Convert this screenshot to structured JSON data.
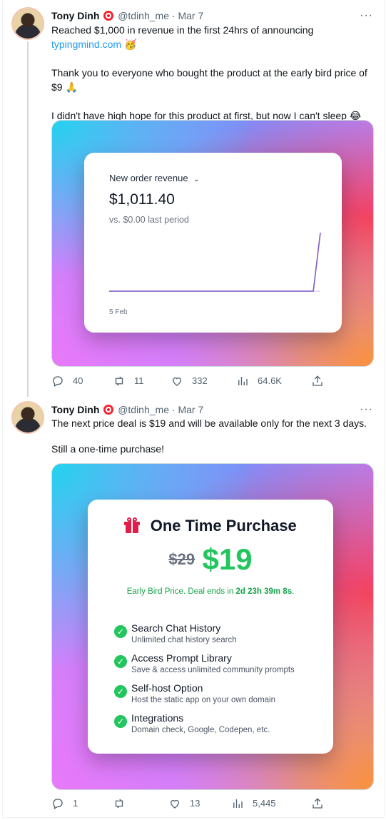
{
  "tweets": [
    {
      "author_name": "Tony Dinh",
      "handle": "@tdinh_me",
      "separator": "·",
      "date": "Mar 7",
      "text_line1": "Reached $1,000 in revenue in the first 24hrs of announcing",
      "link": "typingmind.com",
      "link_emoji": "🥳",
      "para2_line1": "Thank you to everyone who bought the product at the early bird price of",
      "para2_line2": "$9 🙏",
      "para3": "I didn't have high hope for this product at first, but now I can't sleep 😂",
      "media": {
        "dropdown_label": "New order revenue",
        "amount": "$1,011.40",
        "comparison": "vs. $0.00 last period",
        "x_tick": "5 Feb"
      },
      "actions": {
        "replies": "40",
        "retweets": "11",
        "likes": "332",
        "views": "64.6K"
      }
    },
    {
      "author_name": "Tony Dinh",
      "handle": "@tdinh_me",
      "separator": "·",
      "date": "Mar 7",
      "text_line1": "The next price deal is $19 and will be available only for the next 3 days.",
      "para2": "Still a one-time purchase!",
      "media": {
        "title": "One Time Purchase",
        "old_price": "$29",
        "new_price": "$19",
        "deal_prefix": "Early Bird Price. Deal ends in ",
        "deal_countdown": "2d 23h 39m 8s",
        "deal_suffix": ".",
        "features": [
          {
            "title": "Search Chat History",
            "desc": "Unlimited chat history search"
          },
          {
            "title": "Access Prompt Library",
            "desc": "Save & access unlimited community prompts"
          },
          {
            "title": "Self-host Option",
            "desc": "Host the static app on your own domain"
          },
          {
            "title": "Integrations",
            "desc": "Domain check, Google, Codepen, etc."
          }
        ]
      },
      "actions": {
        "replies": "1",
        "retweets": "",
        "likes": "13",
        "views": "5,445"
      }
    }
  ],
  "chart_data": {
    "type": "line",
    "title": "New order revenue",
    "categories": [
      "5 Feb",
      "",
      "",
      "",
      "",
      "",
      "",
      "",
      "",
      "",
      "",
      "",
      "",
      "",
      "",
      "",
      "",
      "",
      "",
      "",
      "",
      "",
      "",
      "",
      "",
      "",
      "",
      "",
      "",
      "",
      "",
      ""
    ],
    "series": [
      {
        "values": [
          0,
          0,
          0,
          0,
          0,
          0,
          0,
          0,
          0,
          0,
          0,
          0,
          0,
          0,
          0,
          0,
          0,
          0,
          0,
          0,
          0,
          0,
          0,
          0,
          0,
          0,
          0,
          0,
          0,
          0,
          1011.4
        ]
      }
    ],
    "line_color": "#7e5bc7"
  },
  "colors": {
    "accent": "#1d9bf0",
    "price_green": "#22c55e",
    "muted": "#536471"
  }
}
